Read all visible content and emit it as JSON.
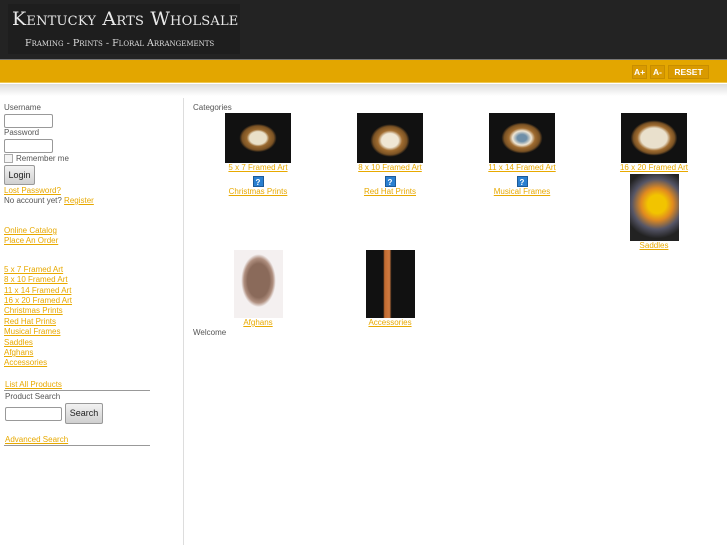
{
  "header": {
    "title": "Kentucky Arts Wholsale",
    "tagline": "Framing - Prints - Floral Arrangements"
  },
  "font_controls": {
    "increase": "A+",
    "decrease": "A-",
    "reset": "RESET"
  },
  "login": {
    "username_label": "Username",
    "username_value": "",
    "password_label": "Password",
    "password_value": "",
    "remember_label": "Remember me",
    "login_button": "Login",
    "lost_password": "Lost Password?",
    "no_account": "No account yet?",
    "register": "Register"
  },
  "nav": {
    "links": [
      "Online Catalog",
      "Place An Order"
    ]
  },
  "categories_menu": [
    "5 x 7 Framed Art",
    "8 x 10 Framed Art",
    "11 x 14 Framed Art",
    "16 x 20 Framed Art",
    "Christmas Prints",
    "Red Hat Prints",
    "Musical Frames",
    "Saddles",
    "Afghans",
    "Accessories"
  ],
  "search": {
    "list_all": "List All Products",
    "label": "Product Search",
    "value": "",
    "button": "Search",
    "advanced": "Advanced Search"
  },
  "main": {
    "categories_heading": "Categories",
    "welcome": "Welcome",
    "items": [
      {
        "label": "5 x 7 Framed Art",
        "image": "framed-art-photo"
      },
      {
        "label": "8 x 10 Framed Art",
        "image": "framed-art-photo"
      },
      {
        "label": "11 x 14 Framed Art",
        "image": "framed-art-photo"
      },
      {
        "label": "16 x 20 Framed Art",
        "image": "framed-art-photo"
      },
      {
        "label": "Christmas Prints",
        "image": "missing-image-icon"
      },
      {
        "label": "Red Hat Prints",
        "image": "missing-image-icon"
      },
      {
        "label": "Musical Frames",
        "image": "missing-image-icon"
      },
      {
        "label": "Saddles",
        "image": "floral-arrangement-photo"
      },
      {
        "label": "Afghans",
        "image": "afghan-photo"
      },
      {
        "label": "Accessories",
        "image": "wind-chime-photo"
      }
    ]
  },
  "colors": {
    "header_bg": "#232323",
    "bar": "#e3a600",
    "link": "#e8a900"
  }
}
